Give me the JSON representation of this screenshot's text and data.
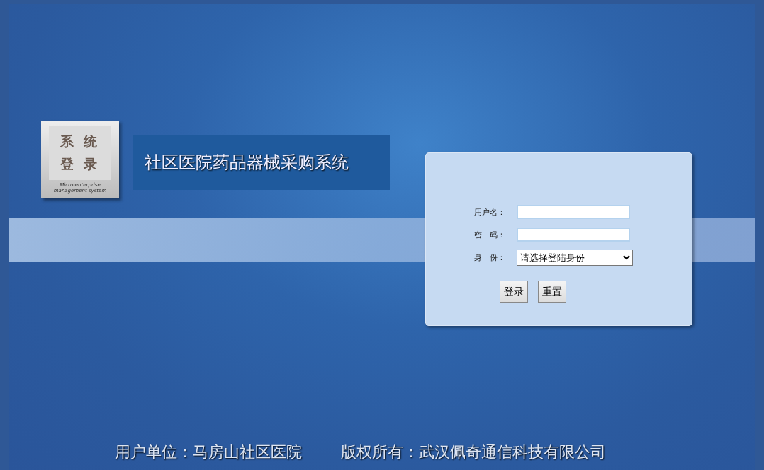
{
  "logo": {
    "lines": [
      "系 统",
      "登 录"
    ],
    "caption": "Micro-enterprise management system"
  },
  "title": "社区医院药品器械采购系统",
  "login": {
    "fields": [
      {
        "kind": "text",
        "label": "用户名："
      },
      {
        "kind": "password",
        "label": "密　码："
      },
      {
        "kind": "select",
        "label": "身　份：",
        "value": "请选择登陆身份"
      }
    ],
    "buttons": [
      "登录",
      "重置"
    ]
  },
  "footer": [
    "用户单位：马房山社区医院",
    "版权所有：武汉佩奇通信科技有限公司"
  ]
}
